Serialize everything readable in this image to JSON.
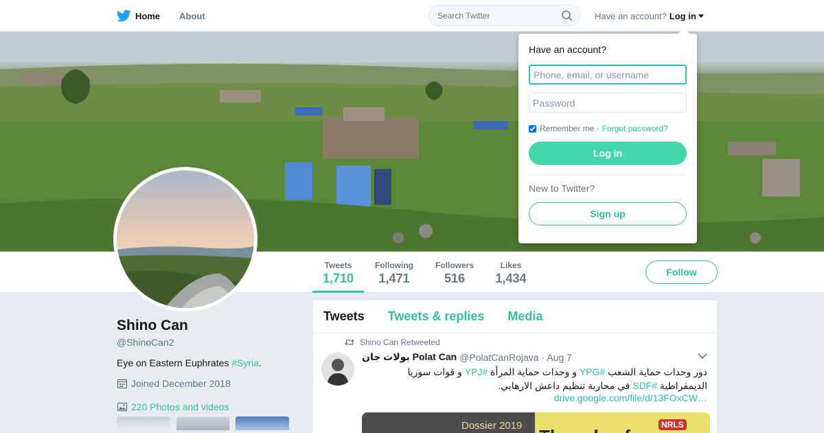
{
  "nav": {
    "home_label": "Home",
    "about_label": "About",
    "search_placeholder": "Search Twitter",
    "account_prompt": "Have an account?",
    "login_label": "Log in"
  },
  "profile": {
    "name": "Shino Can",
    "handle": "@ShinoCan2",
    "bio_text": "Eye on Eastern Euphrates ",
    "bio_hashtag": "#Syria",
    "bio_end": ".",
    "joined": "Joined December 2018",
    "photos_label": "220 Photos and videos"
  },
  "stats": [
    {
      "label": "Tweets",
      "value": "1,710"
    },
    {
      "label": "Following",
      "value": "1,471"
    },
    {
      "label": "Followers",
      "value": "516"
    },
    {
      "label": "Likes",
      "value": "1,434"
    }
  ],
  "follow_label": "Follow",
  "timeline": {
    "tabs": [
      "Tweets",
      "Tweets & replies",
      "Media"
    ],
    "tweet": {
      "retweet_by": "Shino Can Retweeted",
      "author_name": "بولات جان Polat Can",
      "author_handle": "@PolatCanRojava",
      "date": "· Aug 7",
      "text_part1": "دور وحدات حماية الشعب ",
      "tag1": "#YPG",
      "text_part2": " و وحدات حماية المرأة ",
      "tag2": "#YPJ",
      "text_part3": " و قوات سوريا الديمقراطية ",
      "tag3": "#SDF",
      "text_part4": " في محاربة تنظيم داعش الارهابي.",
      "link": "drive.google.com/file/d/13FOxCW…",
      "media_caption": "Dossier 2019",
      "media_logo": "NRLS",
      "media_big": "The role of"
    }
  },
  "login_dropdown": {
    "title": "Have an account?",
    "username_placeholder": "Phone, email, or username",
    "password_placeholder": "Password",
    "remember_label": "Remember me ·",
    "forgot_label": "Forgot password?",
    "login_button": "Log in",
    "new_prompt": "New to Twitter?",
    "signup_button": "Sign up"
  },
  "colors": {
    "accent": "#2fc2a0",
    "login_button_bg": "#45d6aa",
    "twitter_blue": "#1da1f2"
  }
}
